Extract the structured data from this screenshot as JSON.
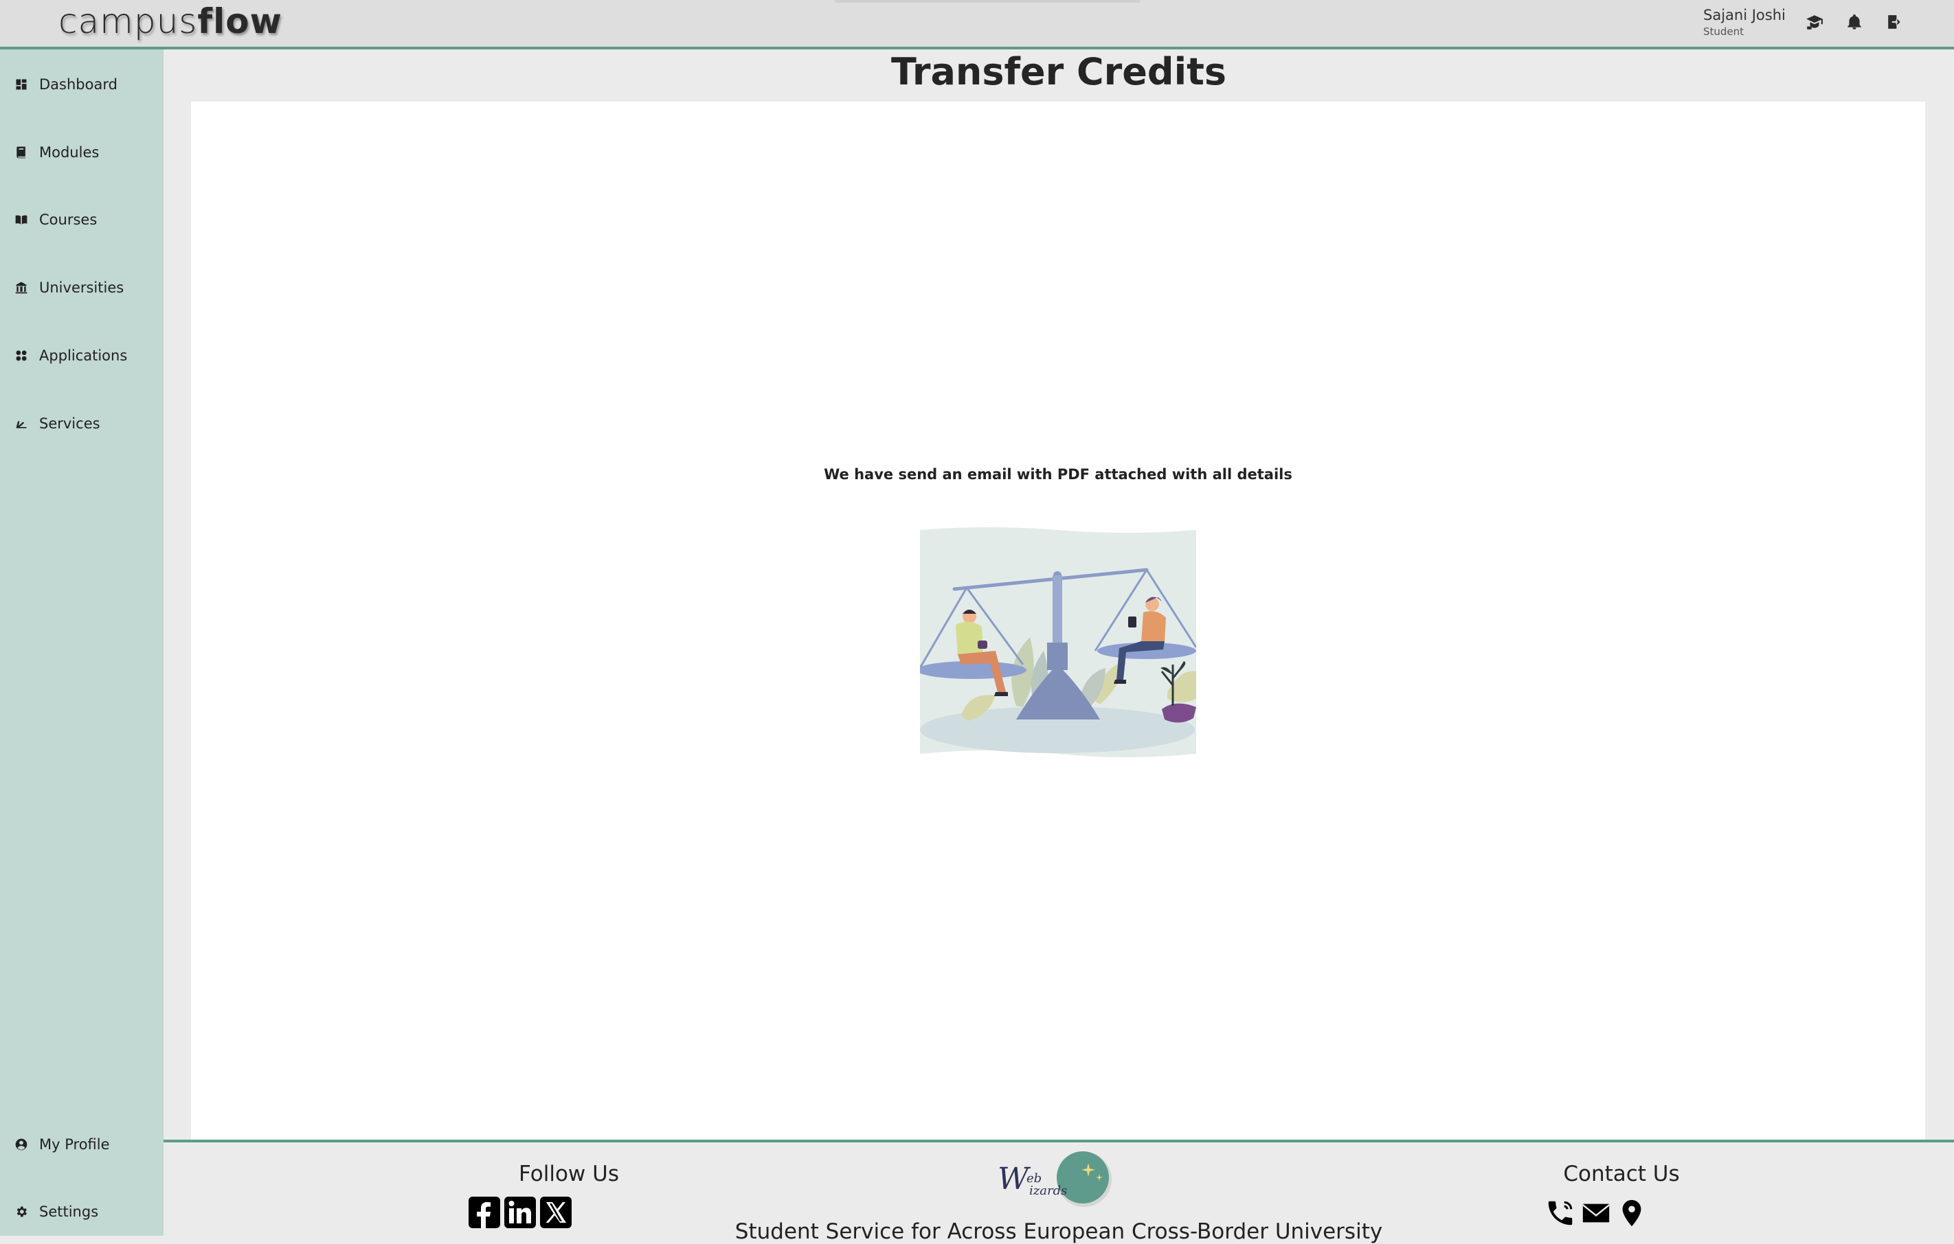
{
  "app": {
    "logo_light": "campus",
    "logo_bold": "flow"
  },
  "header": {
    "user_name": "Sajani Joshi",
    "user_role": "Student",
    "icons": [
      "graduation-cap-icon",
      "bell-icon",
      "logout-icon"
    ]
  },
  "sidebar": {
    "items": [
      {
        "label": "Dashboard",
        "icon": "dashboard-icon"
      },
      {
        "label": "Modules",
        "icon": "book-icon"
      },
      {
        "label": "Courses",
        "icon": "open-book-icon"
      },
      {
        "label": "Universities",
        "icon": "university-icon"
      },
      {
        "label": "Applications",
        "icon": "apps-icon"
      },
      {
        "label": "Services",
        "icon": "services-icon"
      }
    ],
    "bottom_items": [
      {
        "label": "My Profile",
        "icon": "user-circle-icon"
      },
      {
        "label": "Settings",
        "icon": "gear-icon"
      }
    ]
  },
  "main": {
    "title": "Transfer Credits",
    "message": "We have send an email with PDF attached with all details",
    "illustration": "balance-scale-illustration"
  },
  "footer": {
    "follow_title": "Follow Us",
    "social": [
      "facebook-icon",
      "linkedin-icon",
      "x-icon"
    ],
    "contact_title": "Contact Us",
    "contact": [
      "phone-icon",
      "mail-icon",
      "location-pin-icon"
    ],
    "logo": "web-wizards-logo",
    "tagline": "Student Service for Across European Cross-Border University"
  },
  "colors": {
    "accent": "#5e9b8c",
    "sidebar_bg": "#c2d8d2",
    "topbar_bg": "#dedede",
    "page_bg": "#ebebeb",
    "card_bg": "#ffffff"
  }
}
